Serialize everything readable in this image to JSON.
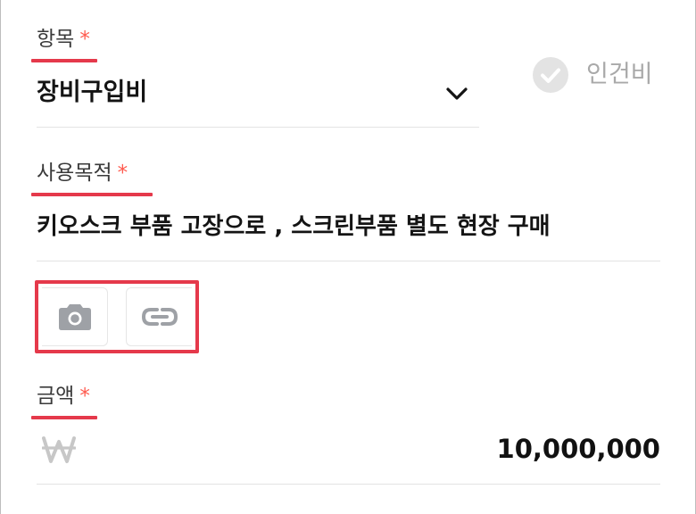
{
  "item": {
    "label": "항목",
    "required_mark": "*",
    "selected_value": "장비구입비",
    "chevron_icon": "chevron-down-icon"
  },
  "labor_cost": {
    "label": "인건비",
    "checked": false,
    "icon": "check-circle-icon"
  },
  "purpose": {
    "label": "사용목적",
    "required_mark": "*",
    "value": "키오스크 부품 고장으로 , 스크린부품 별도 현장 구매"
  },
  "attachments": {
    "buttons": [
      {
        "name": "camera-button",
        "icon": "camera-icon"
      },
      {
        "name": "link-button",
        "icon": "link-icon"
      }
    ]
  },
  "amount": {
    "label": "금액",
    "required_mark": "*",
    "currency_icon": "won-icon",
    "value": "10,000,000"
  },
  "colors": {
    "highlight": "#e5394b",
    "required": "#ff5a4e",
    "icon_gray": "#9ea1a6",
    "muted_text": "#a9a9a9"
  }
}
